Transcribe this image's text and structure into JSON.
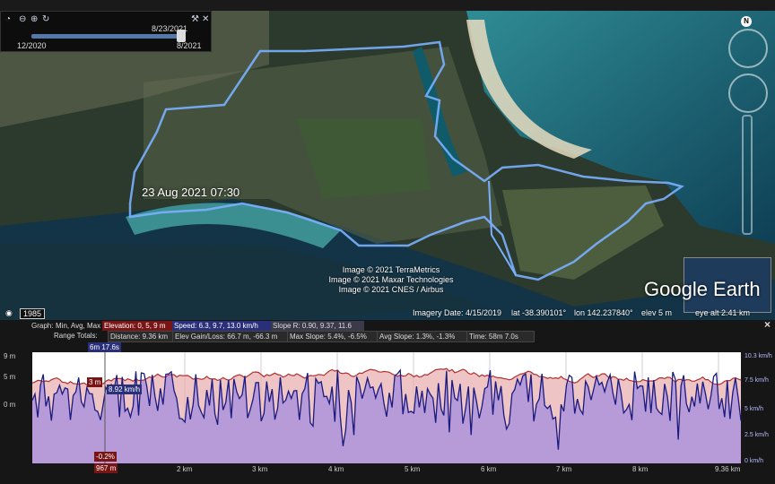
{
  "time_slider": {
    "current_date": "8/23/2021",
    "start": "12/2020",
    "end": "8/2021"
  },
  "map": {
    "timestamp": "23 Aug 2021 07:30",
    "credits": [
      "Image © 2021 TerraMetrics",
      "Image © 2021 Maxar Technologies",
      "Image © 2021 CNES / Airbus"
    ],
    "logo": "Google Earth",
    "north": "N"
  },
  "status_bar": {
    "year": "1985",
    "imagery_date": "Imagery Date: 4/15/2019",
    "lat": "lat  -38.390101°",
    "lon": "lon  142.237840°",
    "elev": "elev     5 m",
    "eye_alt": "eye alt   2.41 km"
  },
  "profile": {
    "graph_label": "Graph:",
    "graph_modes": "Min, Avg, Max",
    "elevation": "Elevation: 0, 5, 9 m",
    "speed": "Speed: 6.3, 9.7, 13.0 km/h",
    "slope": "Slope R: 0.90, 9.37, 11.6",
    "range_label": "Range Totals:",
    "distance": "Distance: 9.36 km",
    "elev_gain": "Elev Gain/Loss: 66.7 m, -66.3 m",
    "max_slope": "Max Slope: 5.4%, -6.5%",
    "avg_slope": "Avg Slope: 1.3%, -1.3%",
    "time": "Time: 58m 7.0s",
    "cursor_time": "6m 17.6s",
    "cursor_elev": "3 m",
    "cursor_speed": "8.92 km/h",
    "cursor_slope": "-0.2%",
    "cursor_dist": "967 m",
    "left_axis": [
      "9 m",
      "5 m",
      "0 m"
    ],
    "right_axis": [
      "10.3 km/h",
      "7.5 km/h",
      "5 km/h",
      "2.5 km/h",
      "0 km/h"
    ],
    "x_axis": [
      "2 km",
      "3 km",
      "4 km",
      "5 km",
      "6 km",
      "7 km",
      "8 km",
      "9.36 km"
    ],
    "close": "×"
  },
  "icons": {
    "earth": "earth-icon",
    "zoom_in": "zoom-in-icon",
    "zoom_out": "zoom-out-icon",
    "refresh": "refresh-icon",
    "wrench": "wrench-icon",
    "close": "close-icon"
  },
  "colors": {
    "track": "#7ab0ff",
    "elevation": "#b03030",
    "speed": "#1a1a80",
    "fill": "#b79ad8"
  }
}
